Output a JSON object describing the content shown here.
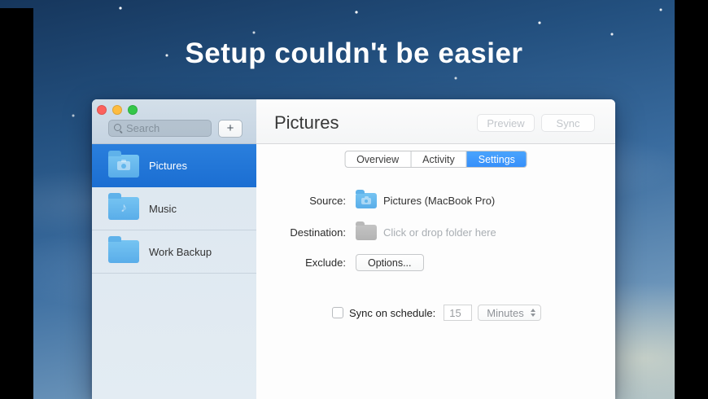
{
  "hero": {
    "heading": "Setup couldn't be easier"
  },
  "window": {
    "titlebar": {
      "search_placeholder": "Search",
      "add_button_label": "+"
    },
    "sidebar": {
      "items": [
        {
          "label": "Pictures",
          "icon": "pictures-folder",
          "selected": true
        },
        {
          "label": "Music",
          "icon": "music-folder",
          "selected": false
        },
        {
          "label": "Work Backup",
          "icon": "plain-folder",
          "selected": false
        }
      ]
    },
    "header": {
      "title": "Pictures",
      "preview_label": "Preview",
      "sync_label": "Sync"
    },
    "tabs": {
      "overview": "Overview",
      "activity": "Activity",
      "settings": "Settings",
      "active": "Settings"
    },
    "form": {
      "source_label": "Source:",
      "source_value": "Pictures (MacBook Pro)",
      "destination_label": "Destination:",
      "destination_placeholder": "Click or drop folder here",
      "exclude_label": "Exclude:",
      "options_button_label": "Options...",
      "schedule_label": "Sync on schedule:",
      "schedule_interval": "15",
      "schedule_unit": "Minutes",
      "schedule_checked": false
    }
  },
  "icons": {
    "music_note": "♪"
  },
  "colors": {
    "selection_blue": "#1b6ed2",
    "tab_active_blue": "#3e9bfc",
    "folder_blue": "#63b7ec",
    "folder_gray": "#bdbdbd",
    "traffic_red": "#fc615d",
    "traffic_yellow": "#fdbc40",
    "traffic_green": "#34c749"
  }
}
